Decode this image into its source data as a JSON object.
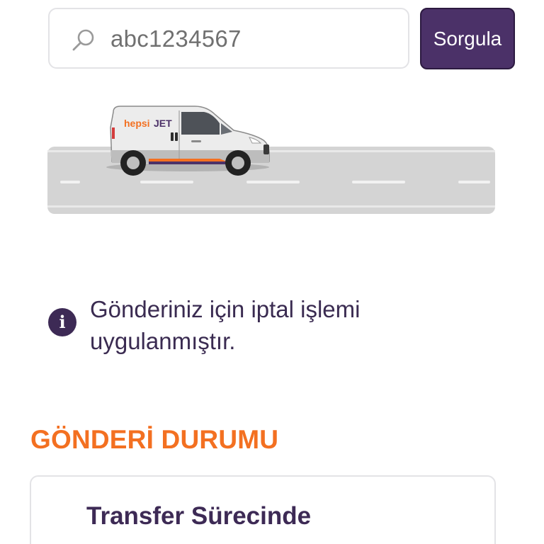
{
  "search": {
    "value": "abc1234567",
    "icon": "search-icon",
    "button_label": "Sorgula"
  },
  "illustration": {
    "van_brand_prefix": "hepsi",
    "van_brand_suffix": "JET",
    "brand_purple": "#4b3168",
    "brand_orange": "#f37021"
  },
  "notice": {
    "icon": "info-icon",
    "message": "Gönderiniz için iptal işlemi uygulanmıştır."
  },
  "shipment_status": {
    "heading": "GÖNDERİ DURUMU",
    "current_status": "Transfer Sürecinde"
  }
}
